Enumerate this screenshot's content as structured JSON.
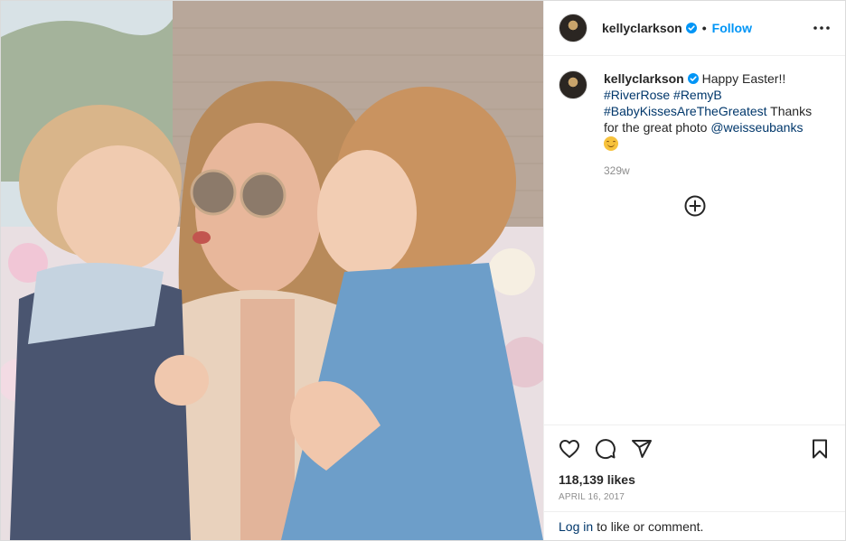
{
  "post": {
    "username": "kellyclarkson",
    "follow_label": "Follow",
    "dot": "•",
    "image_alt": "Photo of Kelly Clarkson with her two children"
  },
  "caption": {
    "username": "kellyclarkson",
    "text_start": "Happy Easter!!",
    "hashtags": [
      "#RiverRose",
      "#RemyB",
      "#BabyKissesAreTheGreatest"
    ],
    "text_mid": "Thanks for the great photo",
    "mention": "@weisseubanks",
    "time_ago": "329w"
  },
  "engagement": {
    "likes": "118,139 likes",
    "date": "APRIL 16, 2017"
  },
  "footer": {
    "login_link": "Log in",
    "login_text": "to like or comment."
  },
  "icons": {
    "verified": "verified-badge-icon",
    "more": "more-options-icon",
    "load_more": "load-more-comments-icon",
    "like": "heart-icon",
    "comment": "comment-icon",
    "share": "share-icon",
    "save": "bookmark-icon"
  },
  "colors": {
    "accent": "#0095f6",
    "link": "#00376b",
    "verified": "#0095f6",
    "muted": "#8e8e8e"
  }
}
